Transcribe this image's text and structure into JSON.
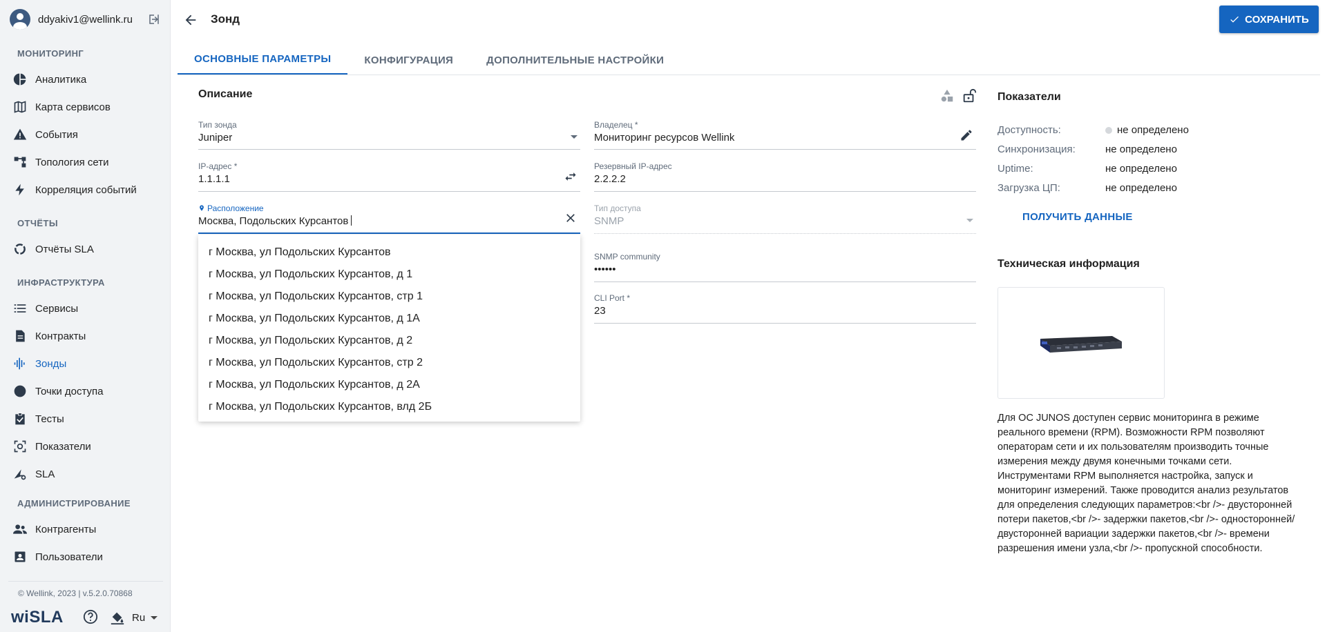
{
  "sidebar": {
    "user_email": "ddyakiv1@wellink.ru",
    "sections": {
      "monitoring": "МОНИТОРИНГ",
      "reports": "ОТЧЁТЫ",
      "infrastructure": "ИНФРАСТРУКТУРА",
      "administration": "АДМИНИСТРИРОВАНИЕ"
    },
    "items": {
      "analytics": "Аналитика",
      "service_map": "Карта сервисов",
      "events": "События",
      "topology": "Топология сети",
      "correlation": "Корреляция событий",
      "sla_reports": "Отчёты SLA",
      "services": "Сервисы",
      "contracts": "Контракты",
      "probes": "Зонды",
      "access_points": "Точки доступа",
      "tests": "Тесты",
      "metrics": "Показатели",
      "sla": "SLA",
      "counterparties": "Контрагенты",
      "users": "Пользователи"
    },
    "copyright": "© Wellink, 2023 | v.5.2.0.70868",
    "logo": "wiSLA",
    "language": "Ru"
  },
  "header": {
    "title": "Зонд",
    "save_label": "СОХРАНИТЬ"
  },
  "tabs": {
    "main": "ОСНОВНЫЕ ПАРАМЕТРЫ",
    "config": "КОНФИГУРАЦИЯ",
    "extra": "ДОПОЛНИТЕЛЬНЫЕ НАСТРОЙКИ"
  },
  "form": {
    "section_title": "Описание",
    "probe_type_label": "Тип зонда",
    "probe_type_value": "Juniper",
    "owner_label": "Владелец *",
    "owner_value": "Мониторинг ресурсов Wellink",
    "ip_label": "IP-адрес *",
    "ip_value": "1.1.1.1",
    "backup_ip_label": "Резервный IP-адрес",
    "backup_ip_value": "2.2.2.2",
    "location_label": "Расположение",
    "location_value": "Москва, Подольских Курсантов",
    "access_type_label": "Тип доступа",
    "access_type_value": "SNMP",
    "snmp_label": "SNMP community",
    "snmp_value": "••••••",
    "cli_label": "CLI Port *",
    "cli_value": "23"
  },
  "suggestions": [
    "г Москва, ул Подольских Курсантов",
    "г Москва, ул Подольских Курсантов, д 1",
    "г Москва, ул Подольских Курсантов, стр 1",
    "г Москва, ул Подольских Курсантов, д 1А",
    "г Москва, ул Подольских Курсантов, д 2",
    "г Москва, ул Подольских Курсантов, стр 2",
    "г Москва, ул Подольских Курсантов, д 2А",
    "г Москва, ул Подольских Курсантов, влд 2Б"
  ],
  "indicators": {
    "title": "Показатели",
    "availability_label": "Доступность:",
    "sync_label": "Синхронизация:",
    "uptime_label": "Uptime:",
    "cpu_label": "Загрузка ЦП:",
    "undefined_value": "не определено",
    "get_data_label": "ПОЛУЧИТЬ ДАННЫЕ"
  },
  "tech": {
    "title": "Техническая информация",
    "description": "Для ОС JUNOS доступен сервис мониторинга в режиме реального времени (RPM). Возможности RPM позволяют операторам сети и их пользователям производить точные измерения между двумя конечными точками сети. Инструментами RPM выполняется настройка, запуск и мониторинг измерений. Также проводится анализ результатов для определения следующих параметров:<br />- двусторонней потери пакетов,<br />- задержки пакетов,<br />- односторонней/двусторонней вариации задержки пакетов,<br />- времени разрешения имени узла,<br />- пропускной способности."
  },
  "colors": {
    "accent": "#1565c0",
    "sidebar_bg": "#f1f3f5",
    "logo": "#213a5c"
  }
}
